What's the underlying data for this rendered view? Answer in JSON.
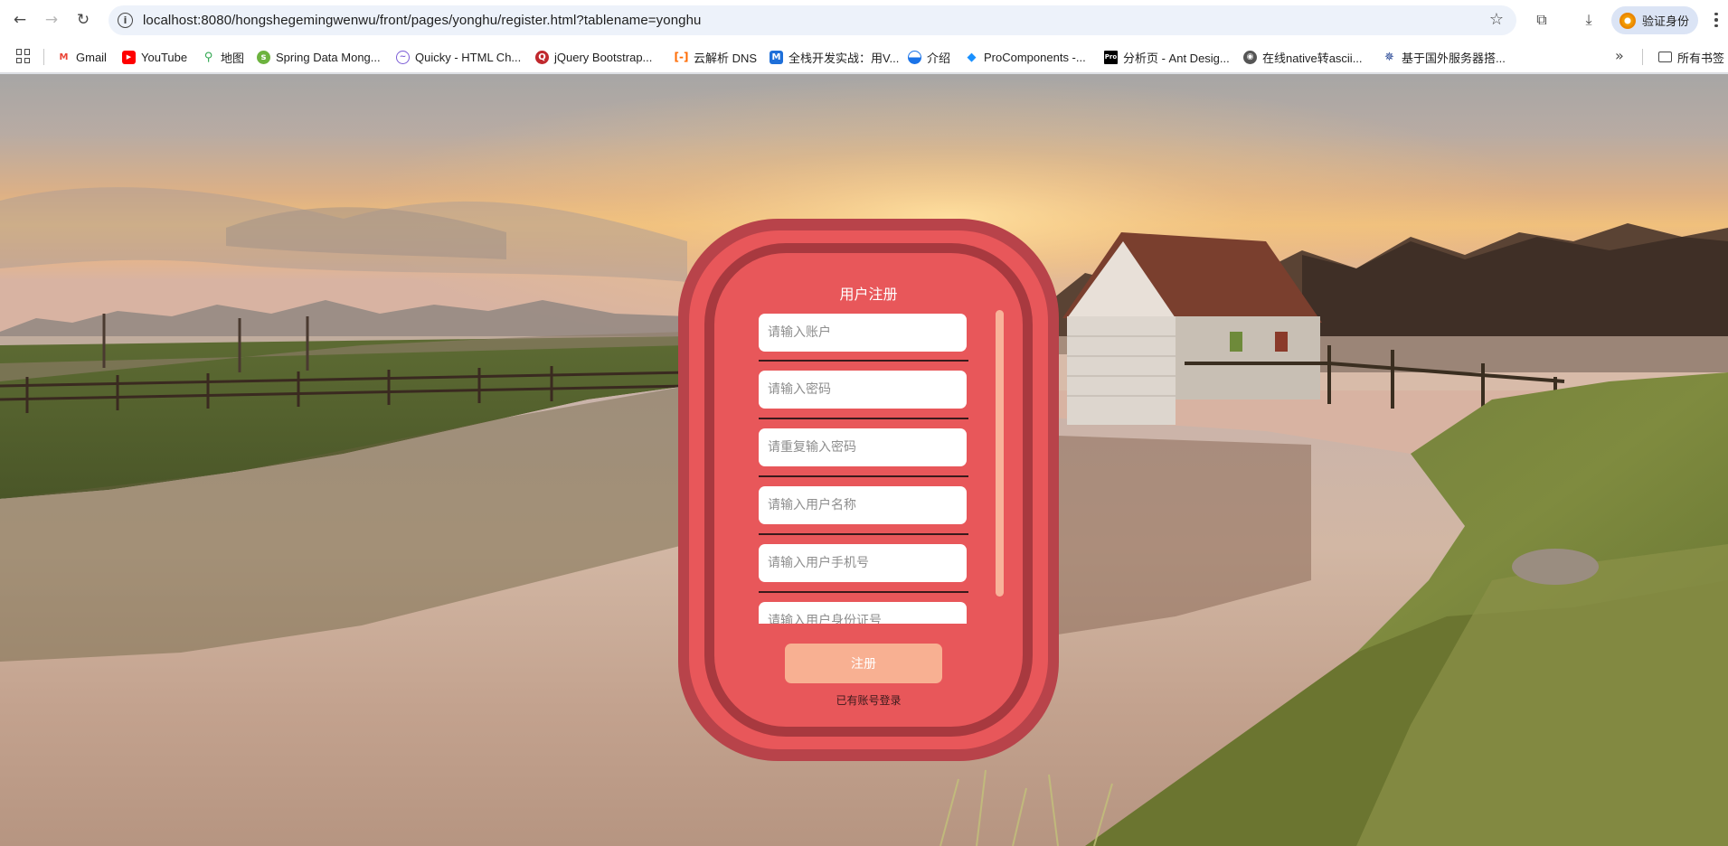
{
  "browser": {
    "url": "localhost:8080/hongshegemingwenwu/front/pages/yonghu/register.html?tablename=yonghu",
    "profile_label": "验证身份",
    "bookmarks": [
      {
        "label": "Gmail",
        "icon": "gmail-icon"
      },
      {
        "label": "YouTube",
        "icon": "youtube-icon"
      },
      {
        "label": "地图",
        "icon": "maps-icon"
      },
      {
        "label": "Spring Data Mong...",
        "icon": "spring-icon"
      },
      {
        "label": "Quicky - HTML Ch...",
        "icon": "quicky-icon"
      },
      {
        "label": "jQuery Bootstrap...",
        "icon": "jquery-icon"
      },
      {
        "label": "云解析 DNS",
        "icon": "aliyun-icon"
      },
      {
        "label": "全栈开发实战：用V...",
        "icon": "m-icon"
      },
      {
        "label": "介绍",
        "icon": "globe-half-icon"
      },
      {
        "label": "ProComponents -...",
        "icon": "procomponents-icon"
      },
      {
        "label": "分析页 - Ant Desig...",
        "icon": "pro-icon"
      },
      {
        "label": "在线native转ascii...",
        "icon": "world-icon"
      },
      {
        "label": "基于国外服务器搭...",
        "icon": "star-logo-icon"
      }
    ],
    "all_bookmarks_label": "所有书签"
  },
  "register": {
    "title": "用户注册",
    "fields": [
      {
        "name": "account-input",
        "placeholder": "请输入账户"
      },
      {
        "name": "password-input",
        "placeholder": "请输入密码"
      },
      {
        "name": "repeat-password-input",
        "placeholder": "请重复输入密码"
      },
      {
        "name": "username-input",
        "placeholder": "请输入用户名称"
      },
      {
        "name": "phone-input",
        "placeholder": "请输入用户手机号"
      },
      {
        "name": "id-card-input",
        "placeholder": "请输入用户身份证号"
      }
    ],
    "submit_label": "注册",
    "login_link": "已有账号登录"
  },
  "colors": {
    "card_outer": "#b8434a",
    "card_fill": "#e8575a",
    "card_ring": "#a8393f",
    "submit_button": "#f8b092",
    "scrollbar": "#f8b39a"
  }
}
